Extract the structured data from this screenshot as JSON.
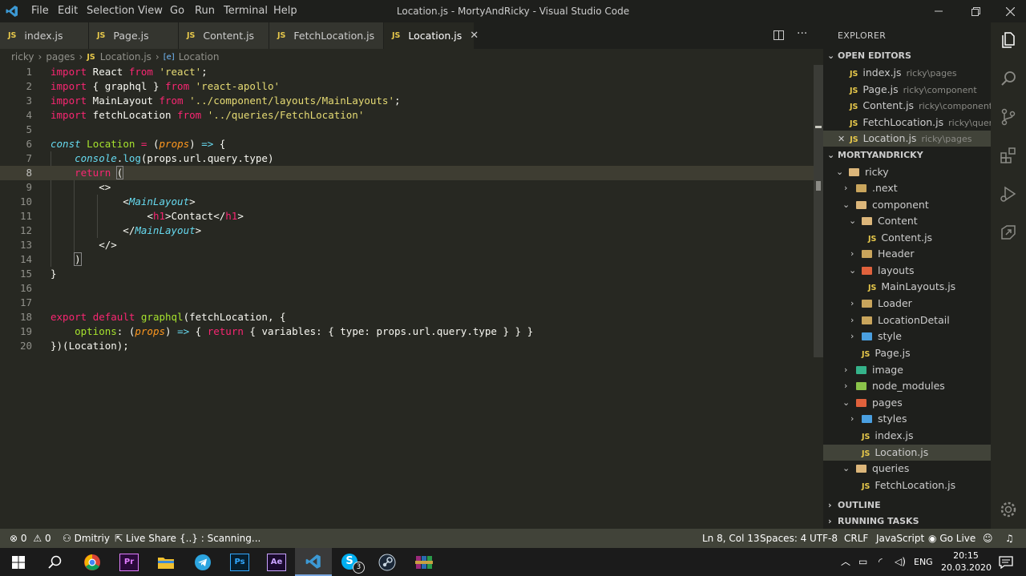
{
  "window": {
    "title": "Location.js - MortyAndRicky - Visual Studio Code",
    "menu": [
      "File",
      "Edit",
      "Selection",
      "View",
      "Go",
      "Run",
      "Terminal",
      "Help"
    ]
  },
  "tabs": [
    {
      "label": "index.js",
      "badge": "JS"
    },
    {
      "label": "Page.js",
      "badge": "JS"
    },
    {
      "label": "Content.js",
      "badge": "JS"
    },
    {
      "label": "FetchLocation.js",
      "badge": "JS"
    },
    {
      "label": "Location.js",
      "badge": "JS",
      "active": true,
      "close": "✕"
    }
  ],
  "breadcrumb": {
    "parts": [
      "ricky",
      "pages"
    ],
    "file": "Location.js",
    "badge": "JS",
    "symbol_icon": "[e]",
    "symbol": "Location"
  },
  "code": {
    "line_numbers": [
      "1",
      "2",
      "3",
      "4",
      "5",
      "6",
      "7",
      "8",
      "9",
      "10",
      "11",
      "12",
      "13",
      "14",
      "15",
      "16",
      "17",
      "18",
      "19",
      "20"
    ],
    "current_line": 8
  },
  "explorer": {
    "header": "EXPLORER",
    "open_editors_title": "OPEN EDITORS",
    "open_editors": [
      {
        "name": "index.js",
        "desc": "ricky\\pages"
      },
      {
        "name": "Page.js",
        "desc": "ricky\\component"
      },
      {
        "name": "Content.js",
        "desc": "ricky\\component\\..."
      },
      {
        "name": "FetchLocation.js",
        "desc": "ricky\\queries"
      },
      {
        "name": "Location.js",
        "desc": "ricky\\pages"
      }
    ],
    "project_title": "MORTYANDRICKY",
    "tree": [
      {
        "name": "ricky",
        "icon": "folder-open-icon"
      },
      {
        "name": ".next",
        "icon": "folder-icon"
      },
      {
        "name": "component",
        "icon": "folder-open-icon"
      },
      {
        "name": "Content",
        "icon": "folder-open-icon"
      },
      {
        "name": "Content.js",
        "icon": "js-file-icon"
      },
      {
        "name": "Header",
        "icon": "folder-icon"
      },
      {
        "name": "layouts",
        "icon": "folder-layouts-icon"
      },
      {
        "name": "MainLayouts.js",
        "icon": "js-file-icon"
      },
      {
        "name": "Loader",
        "icon": "folder-icon"
      },
      {
        "name": "LocationDetail",
        "icon": "folder-icon"
      },
      {
        "name": "style",
        "icon": "folder-style-icon"
      },
      {
        "name": "Page.js",
        "icon": "js-file-icon"
      },
      {
        "name": "image",
        "icon": "folder-image-icon"
      },
      {
        "name": "node_modules",
        "icon": "folder-node-icon"
      },
      {
        "name": "pages",
        "icon": "folder-pages-icon"
      },
      {
        "name": "styles",
        "icon": "folder-style-icon"
      },
      {
        "name": "index.js",
        "icon": "js-file-icon"
      },
      {
        "name": "Location.js",
        "icon": "js-file-icon",
        "selected": true
      },
      {
        "name": "queries",
        "icon": "folder-open-icon"
      },
      {
        "name": "FetchLocation.js",
        "icon": "js-file-icon"
      }
    ],
    "outline_title": "OUTLINE",
    "running_tasks_title": "RUNNING TASKS"
  },
  "statusbar": {
    "errors": "0",
    "warnings": "0",
    "user": "Dmitriy",
    "live_share": "Live Share",
    "scanning": "{..} : Scanning...",
    "cursor": "Ln 8, Col 13",
    "spaces": "Spaces: 4",
    "encoding": "UTF-8",
    "eol": "CRLF",
    "language": "JavaScript",
    "go_live": "Go Live"
  },
  "taskbar": {
    "time": "20:15",
    "date": "20.03.2020",
    "lang": "ENG",
    "skype_badge": "3"
  },
  "colors": {
    "editor_bg": "#272822",
    "sidebar_bg": "#1e1f1c",
    "keyword": "#f92672",
    "string": "#e6db74",
    "function": "#a6e22e"
  }
}
